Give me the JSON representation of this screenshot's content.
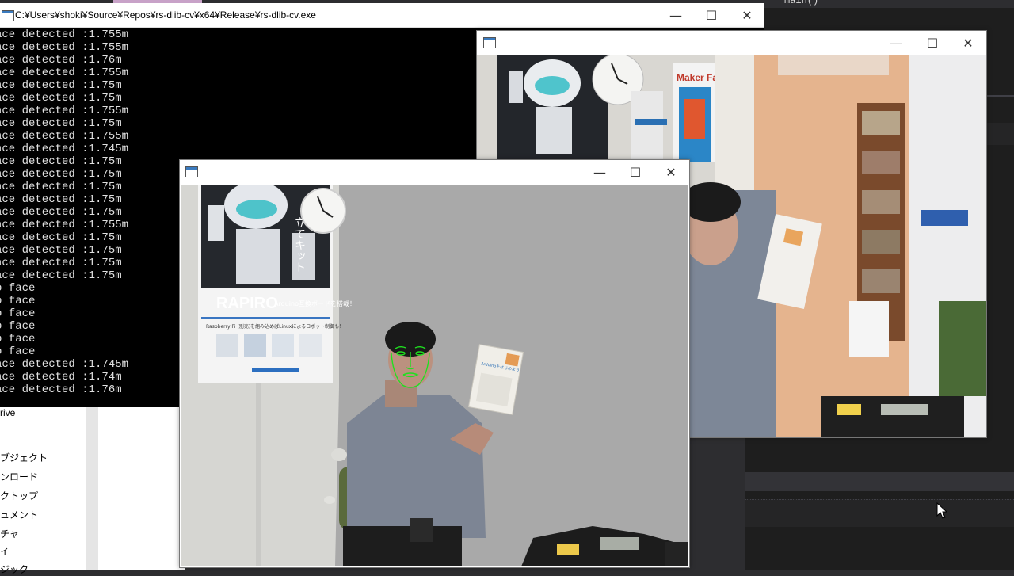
{
  "ide": {
    "code_text": "main()",
    "explorer_items": [
      "rive",
      "ブジェクト",
      "ンロード",
      "クトップ",
      "ュメント",
      "チャ",
      "ィ",
      "ジック"
    ]
  },
  "console": {
    "title": "C:¥Users¥shoki¥Source¥Repos¥rs-dlib-cv¥x64¥Release¥rs-dlib-cv.exe",
    "lines": [
      "ace detected :1.755m",
      "ace detected :1.755m",
      "ace detected :1.76m",
      "ace detected :1.755m",
      "ace detected :1.75m",
      "ace detected :1.75m",
      "ace detected :1.755m",
      "ace detected :1.75m",
      "ace detected :1.755m",
      "ace detected :1.745m",
      "ace detected :1.75m",
      "ace detected :1.75m",
      "ace detected :1.75m",
      "ace detected :1.75m",
      "ace detected :1.75m",
      "ace detected :1.755m",
      "ace detected :1.75m",
      "ace detected :1.75m",
      "ace detected :1.75m",
      "ace detected :1.75m",
      "o face",
      "o face",
      "o face",
      "o face",
      "o face",
      "o face",
      "ace detected :1.745m",
      "ace detected :1.74m",
      "ace detected :1.76m"
    ]
  },
  "window_controls": {
    "minimize": "—",
    "maximize": "☐",
    "close": "✕"
  },
  "color_window": {
    "title": ""
  },
  "depth_window": {
    "title": ""
  },
  "poster": {
    "brand": "RAPIRO",
    "subtitle": "Arduino互換ボードを搭載！",
    "line": "Raspberry Pi (別売)を組み込めばLinuxによるロボット制御も！",
    "kanji": "立てキット",
    "book_title": "Arduinoをはじめよう"
  },
  "colors": {
    "console_bg": "#000000",
    "console_text": "#e0e0e0",
    "ide_bg": "#1e1e1e",
    "landmark_green": "#1fe01f",
    "depth_bg": "#a9a9a9"
  }
}
